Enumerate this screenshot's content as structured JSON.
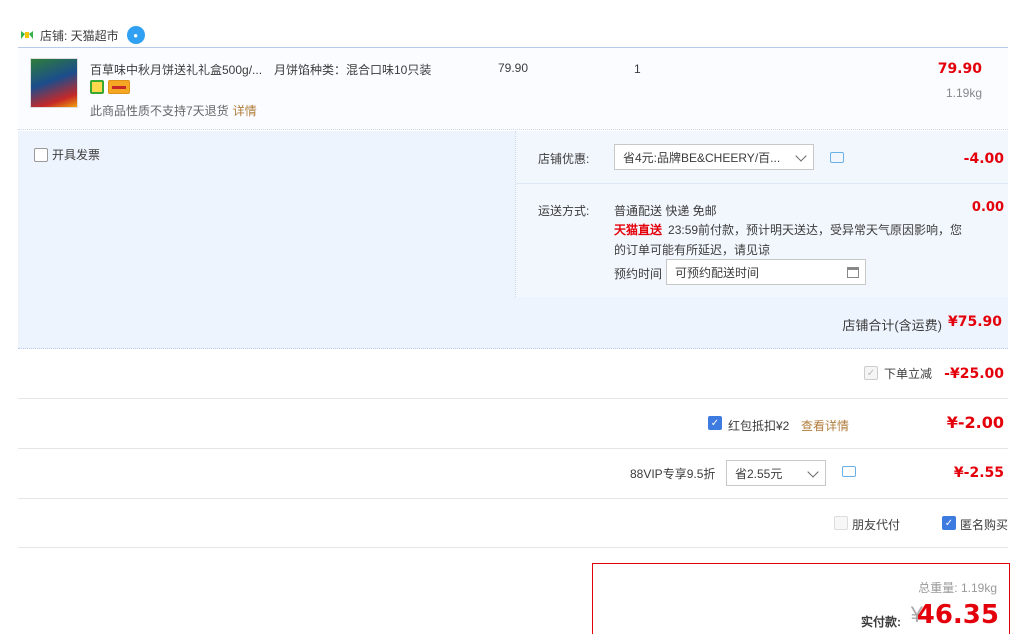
{
  "shop": {
    "label": "店铺: 天猫超市"
  },
  "item": {
    "title": "百草味中秋月饼送礼礼盒500g/...",
    "sku": "月饼馅种类：混合口味10只装",
    "note": "此商品性质不支持7天退货",
    "detail_link": "详情",
    "unit_price": "79.90",
    "quantity": "1",
    "line_total": "79.90",
    "weight": "1.19kg"
  },
  "options": {
    "invoice_label": "开具发票",
    "shop_discount_label": "店铺优惠:",
    "shop_discount_select": "省4元:品牌BE&CHEERY/百...",
    "shop_discount_amount": "-4.00",
    "shipping_label": "运送方式:",
    "shipping_method": "普通配送 快递 免邮",
    "shipping_amount": "0.00",
    "tmall_badge": "天猫直送",
    "shipping_note_1": "23:59前付款，预计明天送达，受异常天气原因影响，您",
    "shipping_note_2": "的订单可能有所延迟，请见谅",
    "appointment_label": "预约时间",
    "appointment_placeholder": "可预约配送时间"
  },
  "subtotal": {
    "label": "店铺合计(含运费)",
    "value": "¥75.90"
  },
  "discounts": {
    "instant_label": "下单立减",
    "instant_value": "-¥25.00",
    "redpacket_label": "红包抵扣¥2",
    "redpacket_link": "查看详情",
    "redpacket_value": "¥-2.00",
    "vip_label": "88VIP专享9.5折",
    "vip_select": "省2.55元",
    "vip_value": "¥-2.55",
    "friend_pay_label": "朋友代付",
    "anonymous_label": "匿名购买"
  },
  "payment": {
    "total_weight": "总重量: 1.19kg",
    "pay_label": "实付款:",
    "currency": "¥",
    "pay_value": "46.35"
  },
  "colors": {
    "price_red": "#e4000b",
    "accent_blue": "#3e7be0",
    "panel_bg": "#eef4fd"
  }
}
